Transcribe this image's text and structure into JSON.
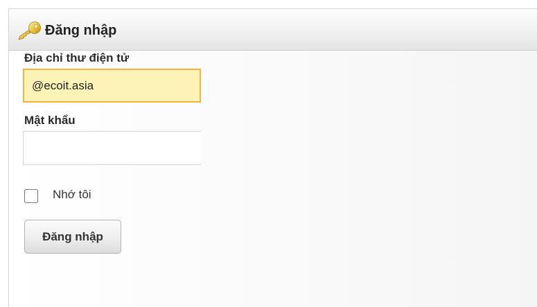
{
  "panel": {
    "title": "Đăng nhập"
  },
  "form": {
    "email_label": "Địa chỉ thư điện tử",
    "email_value": "@ecoit.asia",
    "password_label": "Mật khẩu",
    "password_value": "",
    "remember_label": "Nhớ tôi",
    "remember_checked": false,
    "submit_label": "Đăng nhập"
  },
  "icons": {
    "header_icon": "key-icon"
  },
  "colors": {
    "focus_border": "#f3b33f",
    "focus_background": "#fdf3b7",
    "key_gold": "#e8c23a"
  }
}
